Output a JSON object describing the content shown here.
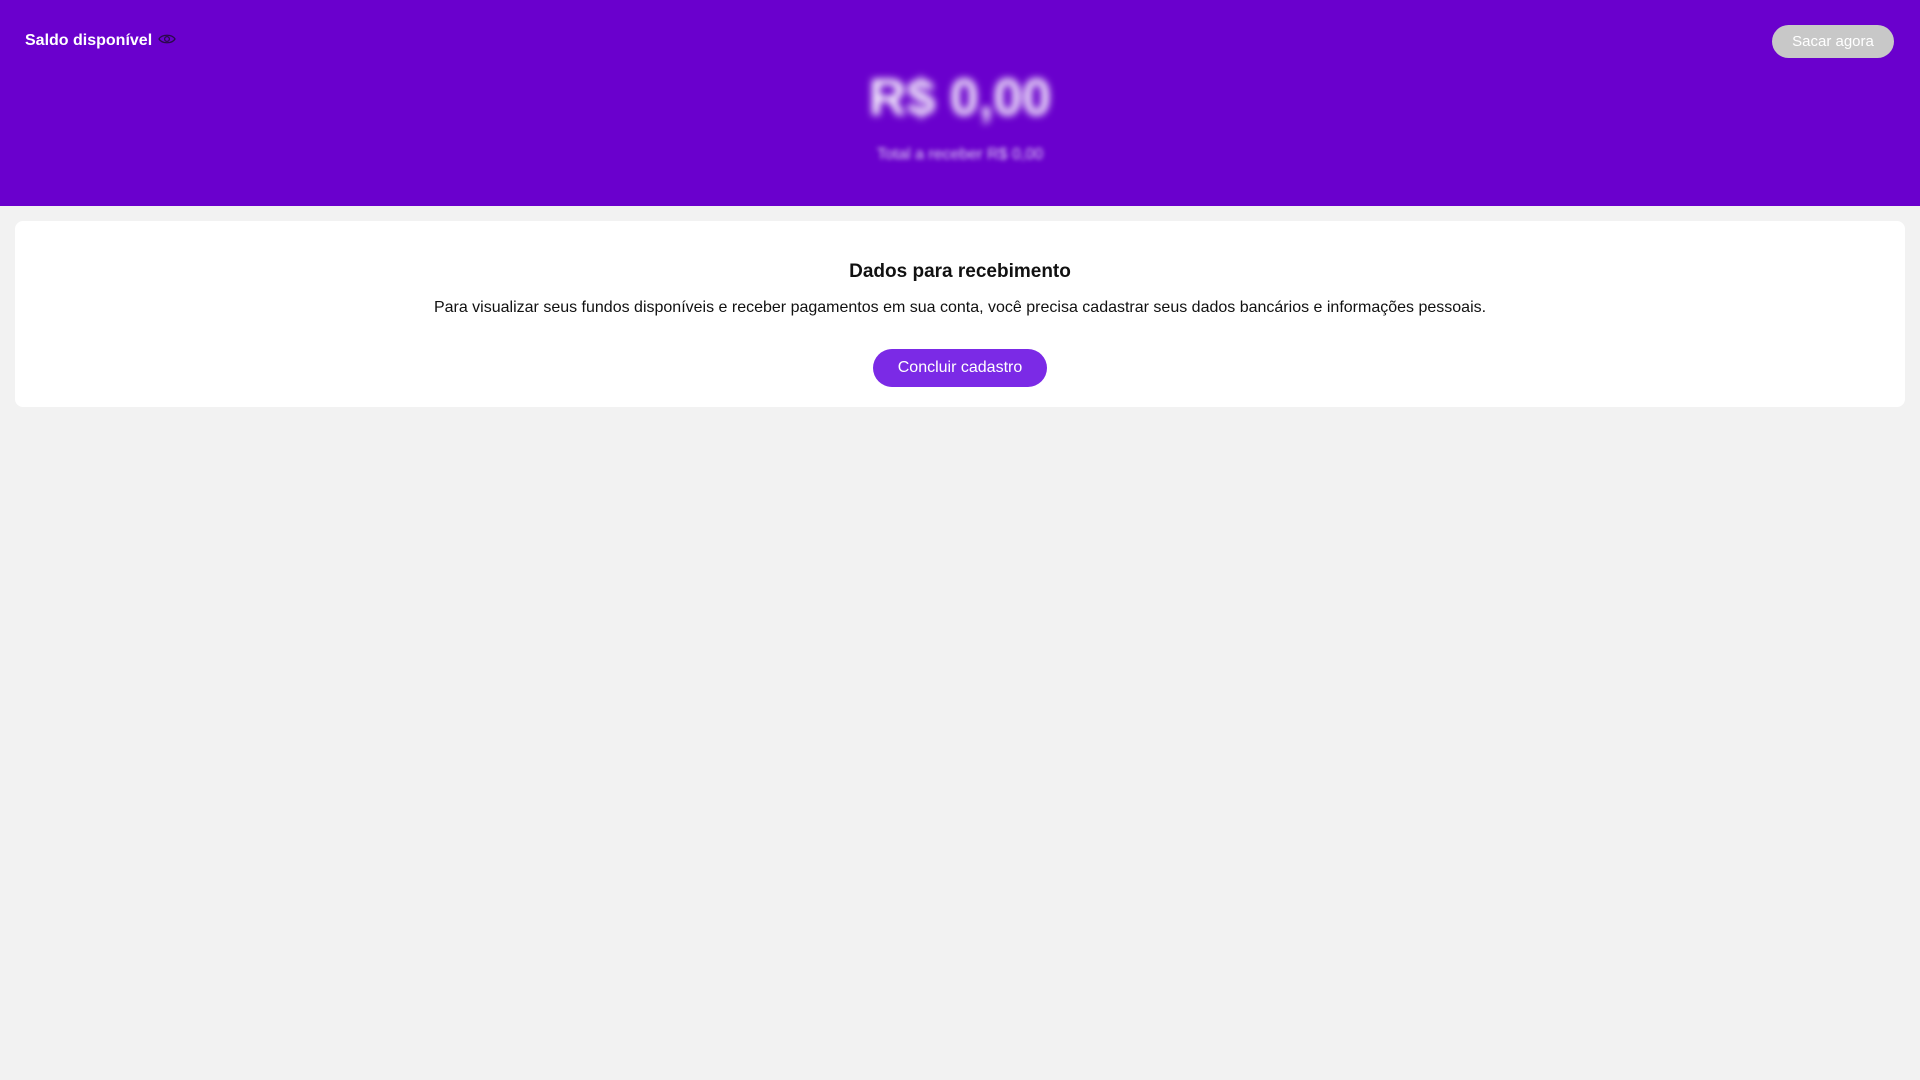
{
  "header": {
    "balance_label": "Saldo disponível",
    "withdraw_label": "Sacar agora",
    "balance_amount": "R$ 0,00",
    "receivable_text": "Total a receber R$ 0,00"
  },
  "card": {
    "title": "Dados para recebimento",
    "description": "Para visualizar seus fundos disponíveis e receber pagamentos em sua conta, você precisa cadastrar seus dados bancários e informações pessoais.",
    "button_label": "Concluir cadastro"
  },
  "icons": {
    "visibility_toggle": "eye-icon"
  },
  "colors": {
    "header_background": "#6a00cd",
    "primary_button": "#7b2ae6",
    "disabled_button": "#c8c8c8",
    "page_background": "#f2f2f2"
  }
}
